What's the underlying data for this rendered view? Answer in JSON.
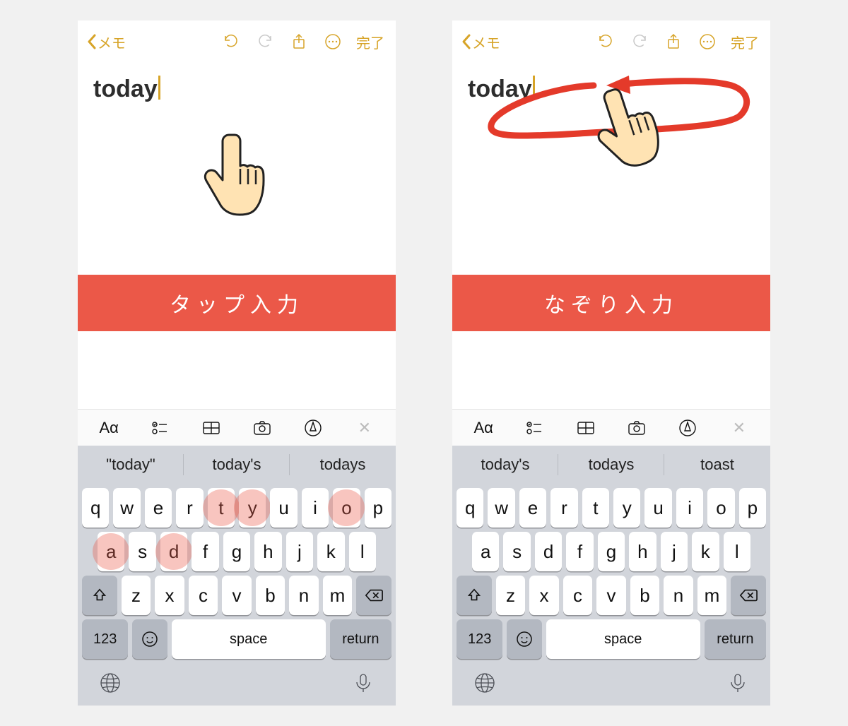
{
  "nav": {
    "back_label": "メモ",
    "done_label": "完了"
  },
  "editor": {
    "text": "today"
  },
  "left": {
    "banner": "タップ入力",
    "predictions": [
      "\"today\"",
      "today's",
      "todays"
    ],
    "highlight_keys": [
      "t",
      "o",
      "d",
      "a",
      "y"
    ]
  },
  "right": {
    "banner": "なぞり入力",
    "predictions": [
      "today's",
      "todays",
      "toast"
    ]
  },
  "format_bar": {
    "text_style_label": "Aα"
  },
  "keyboard": {
    "row1": [
      "q",
      "w",
      "e",
      "r",
      "t",
      "y",
      "u",
      "i",
      "o",
      "p"
    ],
    "row2": [
      "a",
      "s",
      "d",
      "f",
      "g",
      "h",
      "j",
      "k",
      "l"
    ],
    "row3": [
      "z",
      "x",
      "c",
      "v",
      "b",
      "n",
      "m"
    ],
    "num_label": "123",
    "space_label": "space",
    "return_label": "return"
  }
}
